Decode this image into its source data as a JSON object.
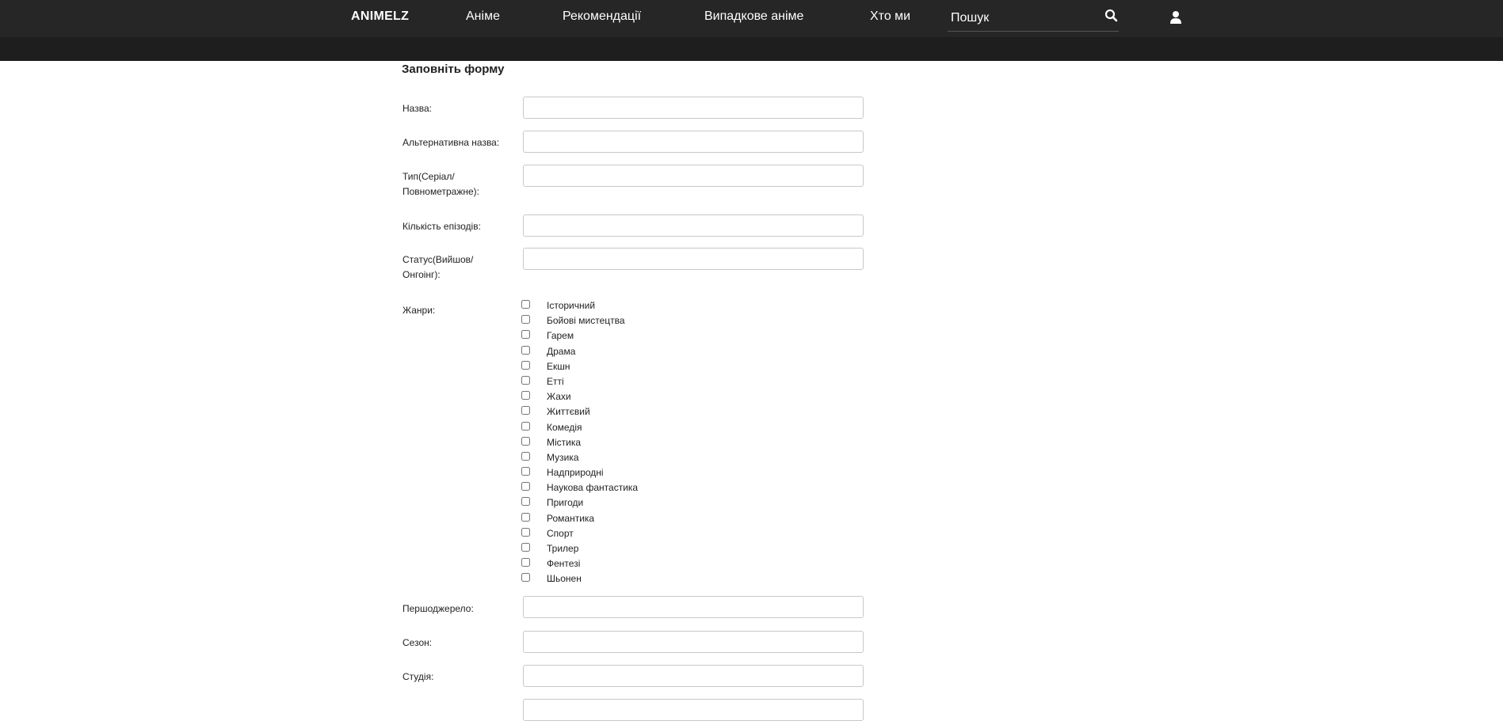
{
  "nav": {
    "logo": "ANIMELZ",
    "anime": "Аніме",
    "recommendations": "Рекомендації",
    "random_anime": "Випадкове аніме",
    "about": "Хто ми",
    "search_placeholder": "Пошук"
  },
  "form": {
    "title": "Заповніть форму",
    "name_label": "Назва:",
    "alt_name_label": "Альтернативна назва:",
    "type_label": "Тип(Серіал/ Повнометражне):",
    "episodes_label": "Кількість епізодів:",
    "status_label": "Статус(Вийшов/ Онгоінг):",
    "genres_label": "Жанри:",
    "genres": [
      "Історичний",
      "Бойові мистецтва",
      "Гарем",
      "Драма",
      "Екшн",
      "Етті",
      "Жахи",
      "Життєвий",
      "Комедія",
      "Містика",
      "Музика",
      "Надприродні",
      "Наукова фантастика",
      "Пригоди",
      "Романтика",
      "Спорт",
      "Трилер",
      "Фентезі",
      "Шьонен"
    ],
    "source_label": "Першоджерело:",
    "season_label": "Сезон:",
    "studio_label": "Студія:"
  }
}
